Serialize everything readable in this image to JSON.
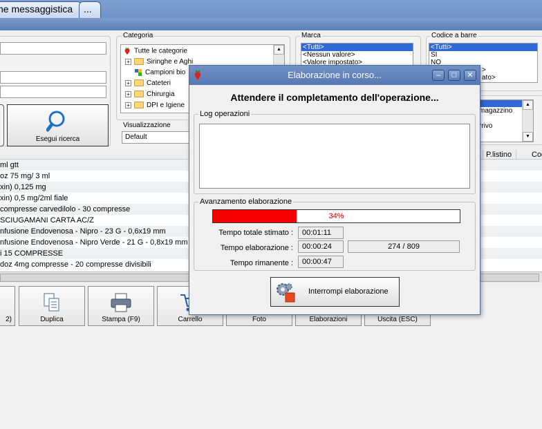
{
  "tabs": [
    {
      "label": "ne messaggistica"
    },
    {
      "label": "..."
    }
  ],
  "filters": {
    "categoria": {
      "label": "Categoria",
      "items": [
        "Tutte le categorie",
        "Siringhe e Aghi",
        "Campioni bio",
        "Cateteri",
        "Chirurgia",
        "DPI e Igiene"
      ]
    },
    "marca": {
      "label": "Marca",
      "options": [
        "<Tutti>",
        "<Nessun valore>",
        "<Valore impostato>"
      ]
    },
    "codice_barre": {
      "label": "Codice a barre",
      "options": [
        "<Tutti>",
        "SI",
        "NO",
        ">",
        "ato>"
      ]
    },
    "other_list": {
      "options": [
        "",
        "magazzino",
        "",
        "rrivo"
      ]
    },
    "visualizzazione": {
      "label": "Visualizzazione",
      "value": "Default"
    },
    "search_button": "Esegui ricerca"
  },
  "grid": {
    "columns": [
      "P.listino",
      "Cod"
    ],
    "rows": [
      "ml gtt",
      "oz 75 mg/ 3 ml",
      "xin) 0,125 mg",
      "xin) 0,5 mg/2ml fiale",
      "compresse carvedilolo - 30 compresse",
      "SCIUGAMANI CARTA AC/Z",
      "nfusione Endovenosa - Nipro - 23 G - 0,6x19 mm",
      "nfusione Endovenosa - Nipro Verde - 21 G - 0,8x19 mm",
      "i 15 COMPRESSE",
      "doz 4mg compresse - 20 compresse divisibili"
    ]
  },
  "bottom_buttons": [
    {
      "label": "2)"
    },
    {
      "label": "Duplica"
    },
    {
      "label": "Stampa (F9)"
    },
    {
      "label": "Carrello"
    },
    {
      "label": "Foto"
    },
    {
      "label": "Elaborazioni"
    },
    {
      "label": "Uscita (ESC)"
    }
  ],
  "dialog": {
    "title": "Elaborazione in corso...",
    "heading": "Attendere il completamento dell'operazione...",
    "log_label": "Log operazioni",
    "progress_label": "Avanzamento elaborazione",
    "progress_percent": 34,
    "progress_text": "34%",
    "tempo_totale_label": "Tempo totale stimato :",
    "tempo_totale_value": "00:01:11",
    "tempo_elab_label": "Tempo elaborazione :",
    "tempo_elab_value": "00:00:24",
    "count_value": "274 / 809",
    "tempo_rim_label": "Tempo rimanente :",
    "tempo_rim_value": "00:00:47",
    "stop_button": "Interrompi elaborazione"
  },
  "colors": {
    "progress_fill": "#f60000",
    "title_bar": "#5f80b9",
    "selection": "#3069d6"
  }
}
